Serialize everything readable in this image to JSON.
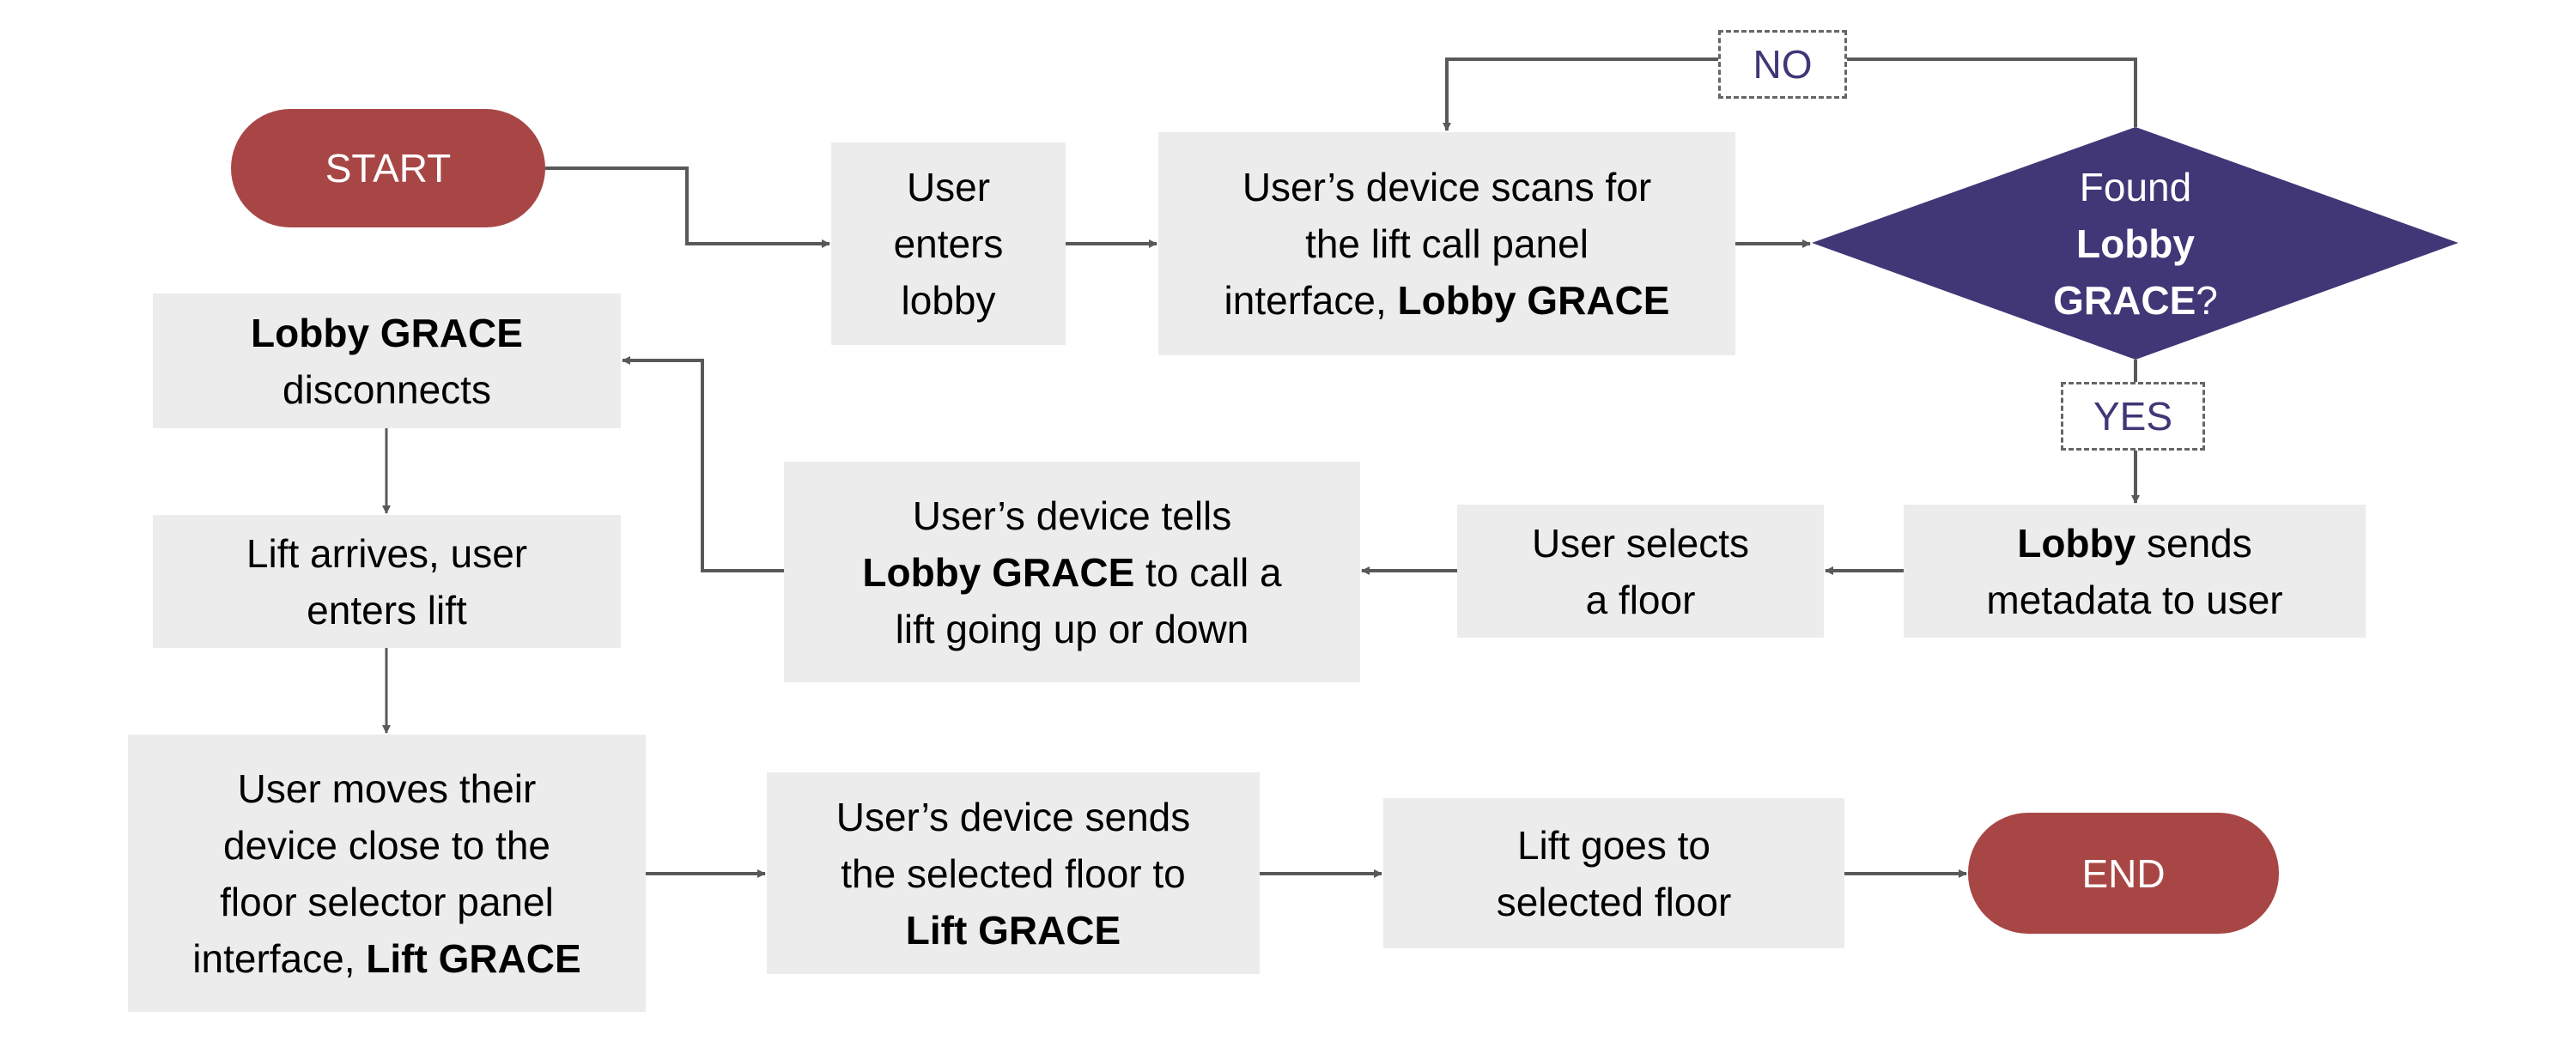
{
  "colors": {
    "terminal": "#a84646",
    "decision": "#413676",
    "process": "#ececec",
    "connector": "#595959"
  },
  "start": "START",
  "end": "END",
  "labels": {
    "no": "NO",
    "yes": "YES"
  },
  "decision": {
    "line1": "Found",
    "line2": "Lobby",
    "line3_bold": "GRACE",
    "line3_rest": "?"
  },
  "steps": {
    "enters_lobby": [
      "User",
      "enters",
      "lobby"
    ],
    "scans": {
      "l1": "User’s device scans for",
      "l2": "the lift call panel",
      "l3a": "interface, ",
      "l3b": "Lobby GRACE"
    },
    "sends_metadata": {
      "l1a": "Lobby",
      "l1b": " sends",
      "l2": "metadata to user"
    },
    "selects_floor": [
      "User selects",
      "a floor"
    ],
    "tells": {
      "l1": "User’s device tells",
      "l2a": "Lobby GRACE",
      "l2b": " to call a",
      "l3": "lift going up or down"
    },
    "disconnects": {
      "l1": "Lobby GRACE",
      "l2": "disconnects"
    },
    "lift_arrives": [
      "Lift arrives, user",
      "enters lift"
    ],
    "moves": {
      "l1": "User moves their",
      "l2": "device close to the",
      "l3": "floor selector panel",
      "l4a": "interface, ",
      "l4b": "Lift GRACE"
    },
    "sends_floor": {
      "l1": "User’s device sends",
      "l2": "the selected floor to",
      "l3": "Lift GRACE"
    },
    "lift_goes": [
      "Lift goes to",
      "selected floor"
    ]
  }
}
